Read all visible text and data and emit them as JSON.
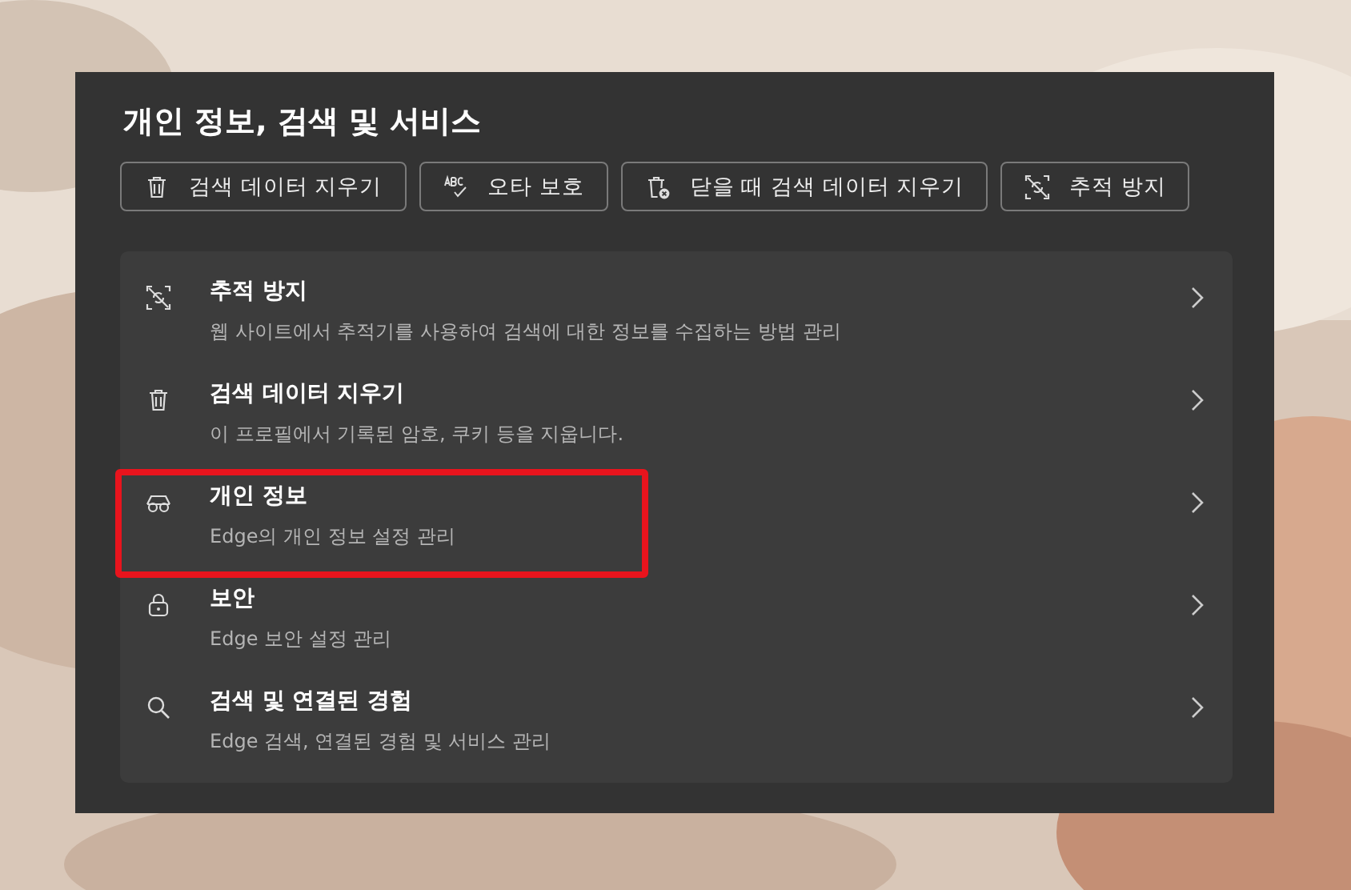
{
  "panel": {
    "title": "개인 정보, 검색 및 서비스",
    "quick_buttons": [
      {
        "kind": "trash",
        "label": "검색 데이터 지우기"
      },
      {
        "kind": "spell",
        "label": "오타 보호"
      },
      {
        "kind": "trash-x",
        "label": "닫을 때 검색 데이터 지우기"
      },
      {
        "kind": "tracking",
        "label": "추적 방지"
      }
    ],
    "items": [
      {
        "kind": "tracking",
        "title": "추적 방지",
        "description": "웹 사이트에서 추적기를 사용하여 검색에 대한 정보를 수집하는 방법 관리",
        "highlighted": false
      },
      {
        "kind": "trash",
        "title": "검색 데이터 지우기",
        "description": "이 프로필에서 기록된 암호, 쿠키 등을 지웁니다.",
        "highlighted": false
      },
      {
        "kind": "glasses",
        "title": "개인 정보",
        "description": "Edge의 개인 정보 설정 관리",
        "highlighted": true
      },
      {
        "kind": "lock",
        "title": "보안",
        "description": "Edge 보안 설정 관리",
        "highlighted": false
      },
      {
        "kind": "search",
        "title": "검색 및 연결된 경험",
        "description": "Edge 검색, 연결된 경험 및 서비스 관리",
        "highlighted": false
      }
    ]
  }
}
